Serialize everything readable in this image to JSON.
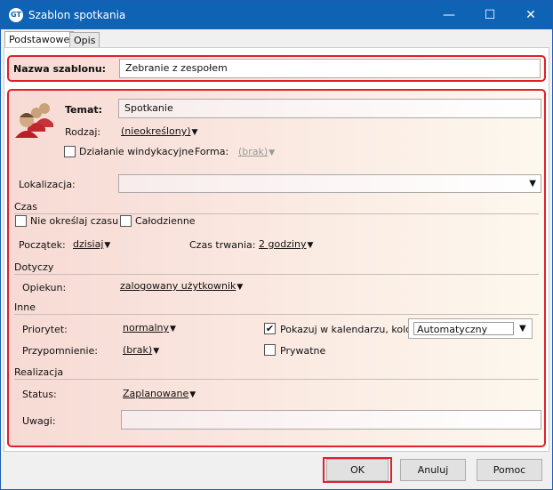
{
  "window": {
    "title": "Szablon spotkania",
    "logo": "GT",
    "minimize": "—",
    "maximize": "☐",
    "close": "✕"
  },
  "tabs": [
    {
      "label": "Podstawowe",
      "active": true
    },
    {
      "label": "Opis",
      "active": false
    }
  ],
  "template_name": {
    "label": "Nazwa szablonu:",
    "value": "Zebranie z zespołem"
  },
  "main": {
    "icon": "people-group-icon",
    "temat": {
      "label": "Temat:",
      "value": "Spotkanie"
    },
    "rodzaj": {
      "label": "Rodzaj:",
      "value": "(nieokreślony)"
    },
    "windykacja": {
      "label": "Działanie windykacyjne",
      "checked": false
    },
    "forma": {
      "label": "Forma:",
      "value": "(brak)"
    },
    "lokalizacja": {
      "label": "Lokalizacja:",
      "value": ""
    }
  },
  "czas": {
    "header": "Czas",
    "nie_okreslaj": {
      "label": "Nie określaj czasu",
      "checked": false
    },
    "calodzienne": {
      "label": "Całodzienne",
      "checked": false
    },
    "poczatek": {
      "label": "Początek:",
      "value": "dzisiaj"
    },
    "trwanie": {
      "label": "Czas trwania:",
      "value": "2 godziny"
    }
  },
  "dotyczy": {
    "header": "Dotyczy",
    "opiekun": {
      "label": "Opiekun:",
      "value": "zalogowany użytkownik"
    }
  },
  "inne": {
    "header": "Inne",
    "priorytet": {
      "label": "Priorytet:",
      "value": "normalny"
    },
    "pokazuj": {
      "label": "Pokazuj w kalendarzu, kolor:",
      "checked": true,
      "check": "✔"
    },
    "kolor": {
      "value": "Automatyczny"
    },
    "przypomnienie": {
      "label": "Przypomnienie:",
      "value": "(brak)"
    },
    "prywatne": {
      "label": "Prywatne",
      "checked": false
    }
  },
  "realizacja": {
    "header": "Realizacja",
    "status": {
      "label": "Status:",
      "value": "Zaplanowane"
    },
    "uwagi": {
      "label": "Uwagi:",
      "value": ""
    }
  },
  "buttons": {
    "ok": "OK",
    "cancel": "Anuluj",
    "help": "Pomoc"
  },
  "arrow": "▼",
  "colors": {
    "titlebar": "#0f63b5",
    "highlight": "#e0202a"
  }
}
